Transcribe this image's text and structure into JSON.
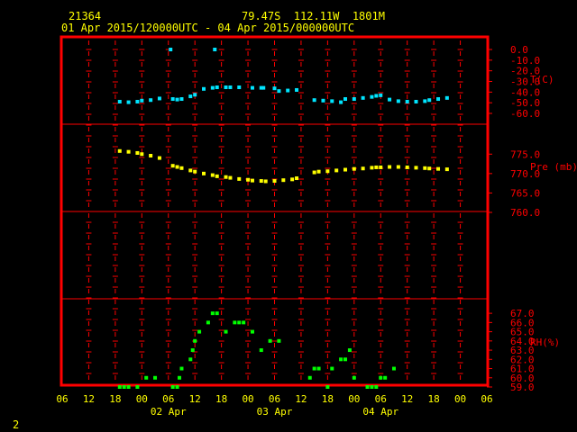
{
  "header": {
    "station_id": "21364",
    "location": "79.47S  112.11W  1801M",
    "time_range": "01 Apr 2015/120000UTC - 04 Apr 2015/000000UTC"
  },
  "footer": {
    "page_number": "2"
  },
  "colors": {
    "frame": "#ff0000",
    "temperature": "#00e5ff",
    "pressure": "#ffff00",
    "humidity": "#00ff00",
    "header_text": "#ffff00",
    "axis_text": "#ffff00"
  },
  "chart_data": [
    {
      "type": "scatter",
      "name": "temperature",
      "ylabel": "T(C)",
      "ylim": [
        -60,
        0
      ],
      "ticks": [
        0,
        -10,
        -20,
        -30,
        -40,
        -50,
        -60
      ],
      "tick_labels": [
        "0.0",
        "-10.0",
        "-20.0",
        "-30.0",
        "-40.0",
        "-50.0",
        "-60.0"
      ],
      "points": [
        [
          13,
          -49
        ],
        [
          15,
          -49.5
        ],
        [
          17,
          -49
        ],
        [
          18,
          -48
        ],
        [
          20,
          -47.5
        ],
        [
          22,
          -46
        ],
        [
          24.5,
          0
        ],
        [
          25,
          -46.5
        ],
        [
          26,
          -47
        ],
        [
          27,
          -46.5
        ],
        [
          29,
          -44
        ],
        [
          30,
          -42.5
        ],
        [
          32,
          -37
        ],
        [
          34,
          -36
        ],
        [
          35,
          -35.5
        ],
        [
          37,
          -35.5
        ],
        [
          38,
          -35.5
        ],
        [
          40,
          -35.5
        ],
        [
          43,
          -36
        ],
        [
          45,
          -36
        ],
        [
          45.5,
          -36
        ],
        [
          48,
          -36.5
        ],
        [
          49,
          -39
        ],
        [
          51,
          -38.5
        ],
        [
          53,
          -38
        ],
        [
          34.5,
          0
        ],
        [
          57,
          -47.5
        ],
        [
          59,
          -48
        ],
        [
          61,
          -48.5
        ],
        [
          63,
          -49.5
        ],
        [
          64,
          -46.5
        ],
        [
          66,
          -46.5
        ],
        [
          68,
          -45.5
        ],
        [
          70,
          -44.5
        ],
        [
          71,
          -43.5
        ],
        [
          72,
          -43
        ],
        [
          74,
          -47
        ],
        [
          76,
          -48.5
        ],
        [
          78,
          -49
        ],
        [
          80,
          -49
        ],
        [
          82,
          -48.5
        ],
        [
          83,
          -47.5
        ],
        [
          85,
          -46.5
        ],
        [
          87,
          -45.5
        ]
      ]
    },
    {
      "type": "scatter",
      "name": "pressure",
      "ylabel": "Pre (mb)",
      "ylim": [
        760,
        779
      ],
      "ticks": [
        775,
        770,
        765,
        760
      ],
      "tick_labels": [
        "775.0",
        "770.0",
        "765.0",
        "760.0"
      ],
      "points": [
        [
          13,
          775.8
        ],
        [
          15,
          775.6
        ],
        [
          17,
          775.3
        ],
        [
          18,
          775
        ],
        [
          20,
          774.6
        ],
        [
          22,
          774
        ],
        [
          25,
          772
        ],
        [
          26,
          771.7
        ],
        [
          27,
          771.4
        ],
        [
          29,
          770.8
        ],
        [
          30,
          770.5
        ],
        [
          32,
          770
        ],
        [
          34,
          769.6
        ],
        [
          35,
          769.3
        ],
        [
          37,
          769.1
        ],
        [
          38,
          768.9
        ],
        [
          40,
          768.6
        ],
        [
          42,
          768.4
        ],
        [
          43,
          768.2
        ],
        [
          45,
          768.1
        ],
        [
          46,
          768
        ],
        [
          48,
          768.1
        ],
        [
          50,
          768.3
        ],
        [
          52,
          768.5
        ],
        [
          53,
          768.8
        ],
        [
          57,
          770.3
        ],
        [
          58,
          770.5
        ],
        [
          60,
          770.6
        ],
        [
          62,
          770.8
        ],
        [
          64,
          771
        ],
        [
          66,
          771.2
        ],
        [
          68,
          771.3
        ],
        [
          70,
          771.5
        ],
        [
          71,
          771.6
        ],
        [
          72,
          771.6
        ],
        [
          74,
          771.7
        ],
        [
          76,
          771.7
        ],
        [
          78,
          771.6
        ],
        [
          80,
          771.5
        ],
        [
          82,
          771.4
        ],
        [
          83,
          771.3
        ],
        [
          85,
          771.2
        ],
        [
          87,
          771.1
        ]
      ]
    },
    {
      "type": "scatter",
      "name": "humidity",
      "ylabel": "RH(%)",
      "ylim": [
        59,
        67.5
      ],
      "ticks": [
        67,
        66,
        65,
        64,
        63,
        62,
        61,
        60,
        59
      ],
      "tick_labels": [
        "67.0",
        "66.0",
        "65.0",
        "64.0",
        "63.0",
        "62.0",
        "61.0",
        "60.0",
        "59.0"
      ],
      "points": [
        [
          13,
          59
        ],
        [
          14,
          59
        ],
        [
          15,
          59
        ],
        [
          17,
          59
        ],
        [
          19,
          60
        ],
        [
          21,
          60
        ],
        [
          25,
          59
        ],
        [
          26,
          59
        ],
        [
          26.5,
          60
        ],
        [
          27,
          61
        ],
        [
          29,
          62
        ],
        [
          29.5,
          63
        ],
        [
          30,
          64
        ],
        [
          31,
          65
        ],
        [
          33,
          66
        ],
        [
          34,
          67
        ],
        [
          35,
          67
        ],
        [
          37,
          65
        ],
        [
          39,
          66
        ],
        [
          40,
          66
        ],
        [
          41,
          66
        ],
        [
          43,
          65
        ],
        [
          45,
          63
        ],
        [
          47,
          64
        ],
        [
          49,
          64
        ],
        [
          56,
          60
        ],
        [
          57,
          61
        ],
        [
          58,
          61
        ],
        [
          60,
          59
        ],
        [
          61,
          61
        ],
        [
          63,
          62
        ],
        [
          64,
          62
        ],
        [
          65,
          63
        ],
        [
          66,
          60
        ],
        [
          69,
          59
        ],
        [
          70,
          59
        ],
        [
          71,
          59
        ],
        [
          72,
          60
        ],
        [
          73,
          60
        ],
        [
          75,
          61
        ]
      ]
    }
  ],
  "x_axis": {
    "range_hours": [
      0,
      96
    ],
    "tick_hours": [
      0,
      6,
      12,
      18,
      24,
      30,
      36,
      42,
      48,
      54,
      60,
      66,
      72,
      78,
      84,
      90,
      96
    ],
    "tick_labels": [
      "06",
      "12",
      "18",
      "00",
      "06",
      "12",
      "18",
      "00",
      "06",
      "12",
      "18",
      "00",
      "06",
      "12",
      "18",
      "00",
      "06"
    ],
    "date_labels": [
      {
        "hour": 24,
        "text": "02 Apr"
      },
      {
        "hour": 48,
        "text": "03 Apr"
      },
      {
        "hour": 72,
        "text": "04 Apr"
      }
    ]
  }
}
